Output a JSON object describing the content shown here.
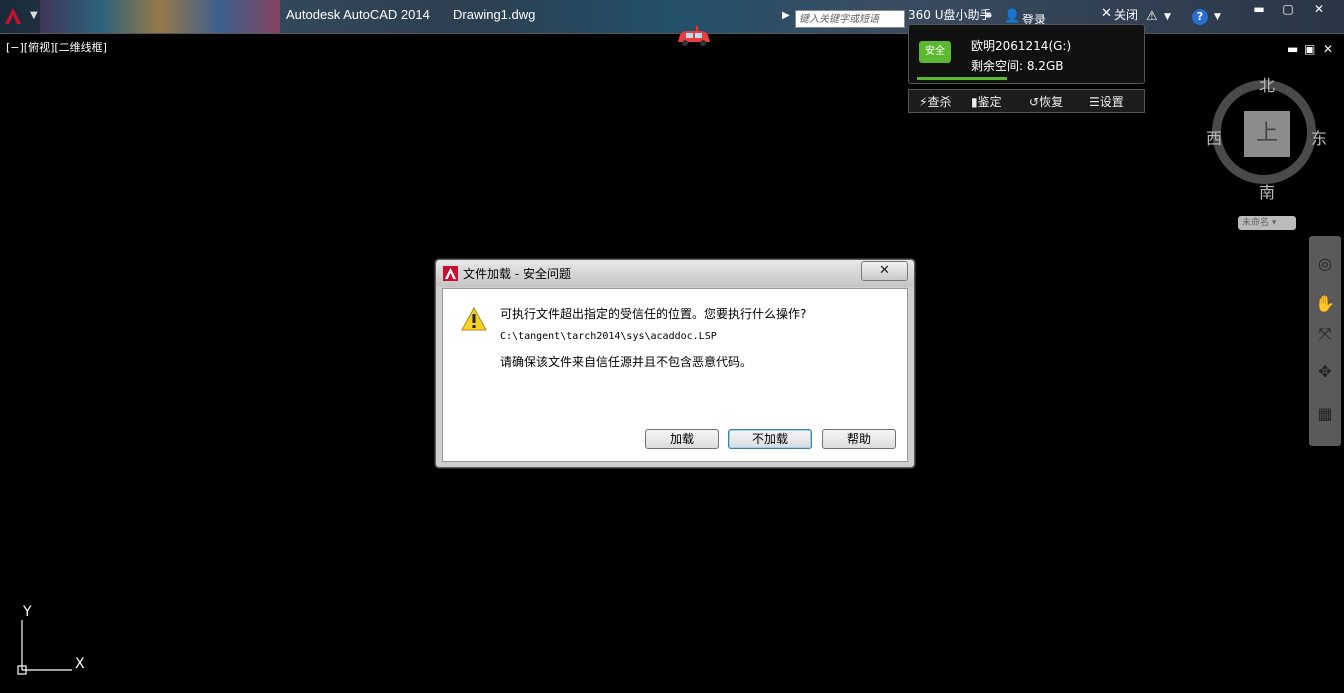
{
  "titlebar": {
    "app_name": "Autodesk AutoCAD 2014",
    "document": "Drawing1.dwg",
    "search_placeholder": "键入关键字或短语",
    "helper_title": "360 U盘小助手",
    "login": "登录",
    "close_helper": "关闭",
    "help": "?",
    "win_minimize": "▬",
    "win_restore": "▢",
    "win_close": "✕"
  },
  "viewport": {
    "label": "[−][俯视][二维线框]",
    "controls": [
      "▬",
      "▣",
      "✕"
    ]
  },
  "usb_helper": {
    "status": "安全",
    "drive_name": "欧明2061214(G:)",
    "free_space": "剩余空间: 8.2GB",
    "tools": [
      "查杀",
      "鉴定",
      "恢复",
      "设置"
    ]
  },
  "viewcube": {
    "north": "北",
    "south": "南",
    "east": "东",
    "west": "西",
    "face": "上",
    "wcs": "未命名"
  },
  "ucs": {
    "x_label": "X",
    "y_label": "Y"
  },
  "dialog": {
    "title": "文件加载 - 安全问题",
    "close": "✕",
    "question": "可执行文件超出指定的受信任的位置。您要执行什么操作?",
    "path": "C:\\tangent\\tarch2014\\sys\\acaddoc.LSP",
    "note": "请确保该文件来自信任源并且不包含恶意代码。",
    "buttons": {
      "load": "加载",
      "dont_load": "不加载",
      "help": "帮助"
    }
  },
  "colors": {
    "autocad_red": "#c8102e",
    "usb_green": "#5cb830",
    "drawing_background": "#000000"
  }
}
